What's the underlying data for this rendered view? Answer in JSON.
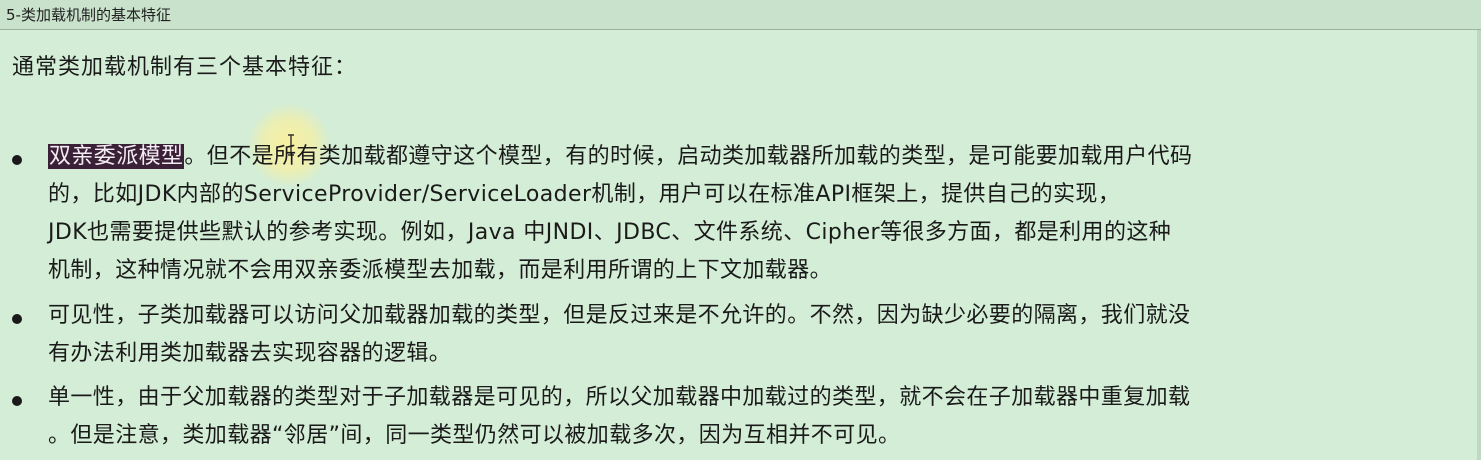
{
  "window": {
    "title": "5-类加载机制的基本特征"
  },
  "intro": "通常类加载机制有三个基本特征：",
  "items": [
    {
      "highlight": "双亲委派模型",
      "lines": [
        "。但不是所有类加载都遵守这个模型，有的时候，启动类加载器所加载的类型，是可能要加载用户代码",
        "的，比如JDK内部的ServiceProvider/ServiceLoader机制，用户可以在标准API框架上，提供自己的实现，",
        "JDK也需要提供些默认的参考实现。例如，Java 中JNDI、JDBC、文件系统、Cipher等很多方面，都是利用的这种",
        "机制，这种情况就不会用双亲委派模型去加载，而是利用所谓的上下文加载器。"
      ]
    },
    {
      "lines": [
        "可见性，子类加载器可以访问父加载器加载的类型，但是反过来是不允许的。不然，因为缺少必要的隔离，我们就没",
        "有办法利用类加载器去实现容器的逻辑。"
      ]
    },
    {
      "lines": [
        "单一性，由于父加载器的类型对于子加载器是可见的，所以父加载器中加载过的类型，就不会在子加载器中重复加载",
        "。但是注意，类加载器“邻居”间，同一类型仍然可以被加载多次，因为互相并不可见。"
      ]
    }
  ],
  "icons": {
    "cursor": "text-cursor-icon",
    "bullet": "bullet-dot-icon"
  }
}
